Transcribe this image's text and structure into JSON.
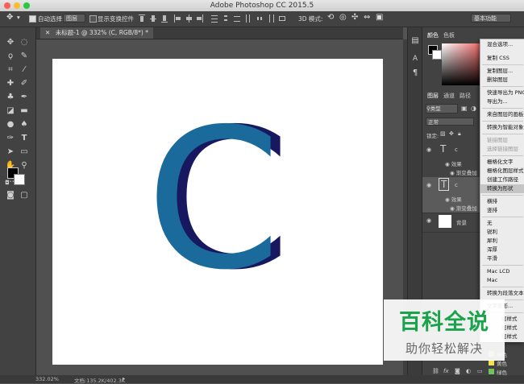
{
  "window": {
    "title": "Adobe Photoshop CC 2015.5"
  },
  "options_bar": {
    "auto_select_label": "自动选择:",
    "auto_select_value": "图层",
    "show_transform_label": "显示变换控件",
    "mode_3d_label": "3D 模式:",
    "workspace": "基本功能"
  },
  "document": {
    "tab_title": "未标题-1 @ 332% (C, RGB/8*) *"
  },
  "canvas": {
    "letter": "C",
    "letter_color": "#1b6a9c",
    "shadow_color": "#171860"
  },
  "status": {
    "zoom": "332.02%",
    "doc_size": "文档:135.2K/402.3K"
  },
  "panels": {
    "color_tabs": [
      "颜色",
      "色板"
    ],
    "layer_tabs": [
      "图层",
      "通道",
      "路径"
    ],
    "filter_label": "类型",
    "blend_mode": "正常",
    "lock_label": "锁定:",
    "layers": [
      {
        "thumb": "T",
        "name": "c",
        "effects_label": "效果",
        "effect": "渐变叠加"
      },
      {
        "thumb": "T",
        "name": "c",
        "effects_label": "效果",
        "effect": "渐变叠加"
      },
      {
        "name": "背景"
      }
    ],
    "swatch_labels": [
      "绿色",
      "黄色",
      "绿色"
    ]
  },
  "context_menu": {
    "items": [
      {
        "label": "混合选项...",
        "disabled": false
      },
      {
        "label": "复制 CSS",
        "disabled": false
      },
      {
        "label": "复制图层...",
        "disabled": false
      },
      {
        "label": "删除图层",
        "disabled": false
      },
      {
        "label": "快速导出为 PNG",
        "disabled": false
      },
      {
        "label": "导出为...",
        "disabled": false
      },
      {
        "label": "来自图层的画板...",
        "disabled": false
      },
      {
        "label": "转换为智能对象",
        "disabled": false
      },
      {
        "label": "链接图层",
        "disabled": true
      },
      {
        "label": "选择链接图层",
        "disabled": true
      },
      {
        "label": "栅格化文字",
        "disabled": false
      },
      {
        "label": "栅格化图层样式",
        "disabled": false
      },
      {
        "label": "创建工作路径",
        "disabled": false
      },
      {
        "label": "转换为形状",
        "disabled": false,
        "highlighted": true
      },
      {
        "label": "横排",
        "disabled": false
      },
      {
        "label": "竖排",
        "disabled": false
      },
      {
        "label": "无",
        "disabled": false
      },
      {
        "label": "锐利",
        "disabled": false
      },
      {
        "label": "犀利",
        "disabled": false
      },
      {
        "label": "浑厚",
        "disabled": false
      },
      {
        "label": "平滑",
        "disabled": false
      },
      {
        "label": "Mac LCD",
        "disabled": false
      },
      {
        "label": "Mac",
        "disabled": false
      },
      {
        "label": "转换为段落文本",
        "disabled": false
      },
      {
        "label": "文字变形...",
        "disabled": false
      },
      {
        "label": "层样式",
        "disabled": false
      },
      {
        "label": "层样式",
        "disabled": false
      },
      {
        "label": "层样式",
        "disabled": false
      }
    ]
  },
  "watermark": {
    "line1": "百科全说",
    "line2": "助你轻松解决"
  }
}
